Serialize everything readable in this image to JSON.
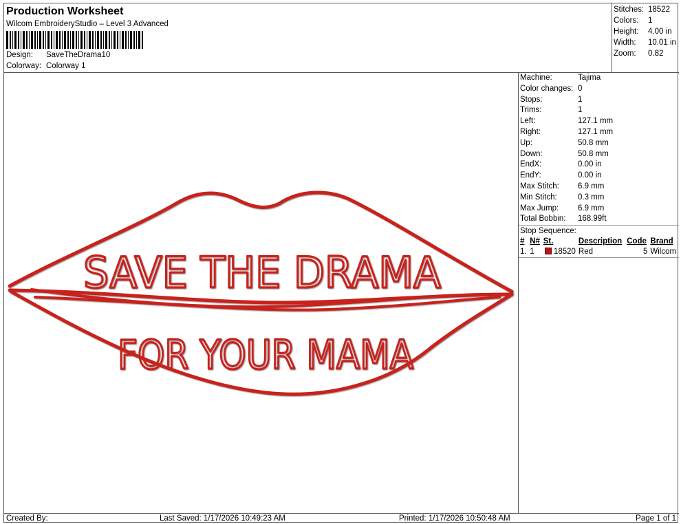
{
  "header": {
    "title": "Production Worksheet",
    "software": "Wilcom EmbroideryStudio – Level 3 Advanced",
    "design_label": "Design:",
    "design_value": "SaveTheDrama10",
    "colorway_label": "Colorway:",
    "colorway_value": "Colorway 1"
  },
  "summary": [
    {
      "label": "Stitches:",
      "value": "18522"
    },
    {
      "label": "Colors:",
      "value": "1"
    },
    {
      "label": "Height:",
      "value": "4.00 in"
    },
    {
      "label": "Width:",
      "value": "10.01 in"
    },
    {
      "label": "Zoom:",
      "value": "0.82"
    }
  ],
  "details": [
    {
      "label": "Machine:",
      "value": "Tajima"
    },
    {
      "label": "Color changes:",
      "value": "0"
    },
    {
      "label": "Stops:",
      "value": "1"
    },
    {
      "label": "Trims:",
      "value": "1"
    },
    {
      "label": "Left:",
      "value": "127.1 mm"
    },
    {
      "label": "Right:",
      "value": "127.1 mm"
    },
    {
      "label": "Up:",
      "value": "50.8 mm"
    },
    {
      "label": "Down:",
      "value": "50.8 mm"
    },
    {
      "label": "EndX:",
      "value": "0.00 in"
    },
    {
      "label": "EndY:",
      "value": "0.00 in"
    },
    {
      "label": "Max Stitch:",
      "value": "6.9 mm"
    },
    {
      "label": "Min Stitch:",
      "value": "0.3 mm"
    },
    {
      "label": "Max Jump:",
      "value": "6.9 mm"
    },
    {
      "label": "Total Bobbin:",
      "value": "168.99ft"
    }
  ],
  "stop_sequence": {
    "title": "Stop Sequence:",
    "columns": [
      "#",
      "N#",
      "St.",
      "Description",
      "Code",
      "Brand"
    ],
    "rows": [
      {
        "num": "1.",
        "n": "1",
        "stitches": "18520",
        "description": "Red",
        "code": "5",
        "brand": "Wilcom",
        "color": "#c0141d"
      }
    ]
  },
  "design": {
    "line1": "SAVE THE DRAMA",
    "line2": "FOR YOUR MAMA",
    "thread_color": "#c8241f"
  },
  "footer": {
    "created": "Created By:",
    "saved": "Last Saved: 1/17/2026 10:49:23 AM",
    "printed": "Printed: 1/17/2026 10:50:48 AM",
    "page": "Page 1 of 1"
  }
}
